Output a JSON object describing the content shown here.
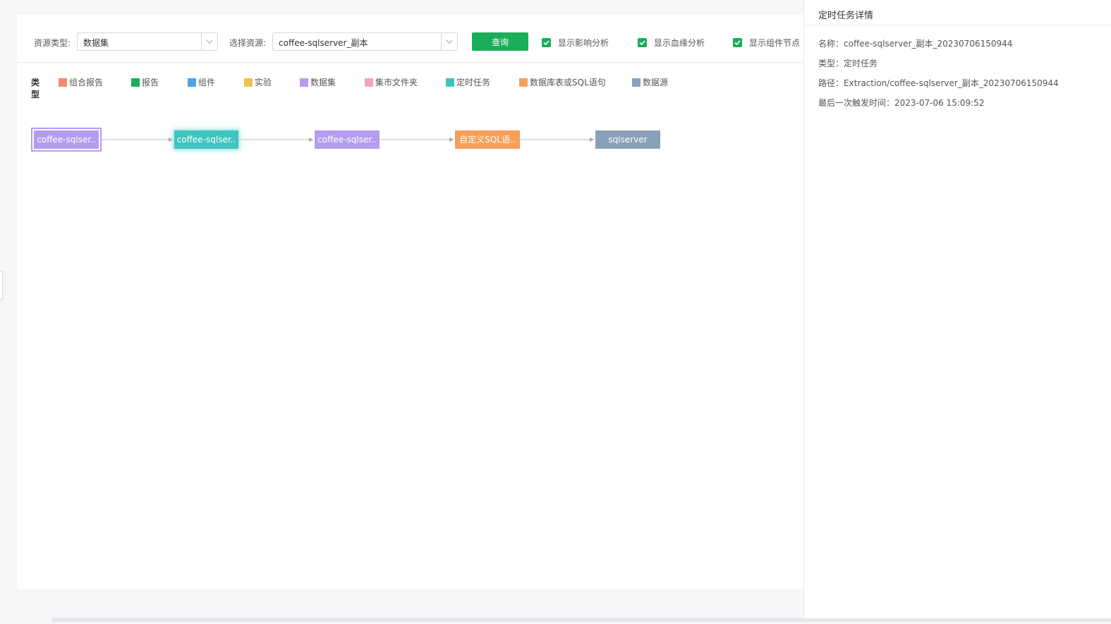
{
  "toolbar": {
    "resource_type_label": "资源类型:",
    "resource_type_value": "数据集",
    "select_resource_label": "选择资源:",
    "select_resource_value": "coffee-sqlserver_副本",
    "query_button": "查询",
    "checkboxes": [
      {
        "label": "显示影响分析",
        "checked": true
      },
      {
        "label": "显示血缘分析",
        "checked": true
      },
      {
        "label": "显示组件节点",
        "checked": true
      }
    ]
  },
  "legend": {
    "title": "类型",
    "items": [
      {
        "label": "组合报告",
        "color": "#f4896e"
      },
      {
        "label": "报告",
        "color": "#1aad5a"
      },
      {
        "label": "组件",
        "color": "#4da3e8"
      },
      {
        "label": "实验",
        "color": "#f2c04a"
      },
      {
        "label": "数据集",
        "color": "#b49cf0"
      },
      {
        "label": "集市文件夹",
        "color": "#f7a1c4"
      },
      {
        "label": "定时任务",
        "color": "#3fc4c0"
      },
      {
        "label": "数据库表或SQL语句",
        "color": "#f59f5b"
      },
      {
        "label": "数据源",
        "color": "#8aa0b8"
      }
    ]
  },
  "graph": {
    "nodes": [
      {
        "label": "coffee-sqlser..",
        "type": "数据集",
        "color": "#b49cf0",
        "selected": true
      },
      {
        "label": "coffee-sqlser..",
        "type": "定时任务",
        "color": "#3fc4c0",
        "highlight": true
      },
      {
        "label": "coffee-sqlser..",
        "type": "数据集",
        "color": "#b49cf0"
      },
      {
        "label": "自定义SQL语..",
        "type": "数据库表或SQL语句",
        "color": "#f59f5b"
      },
      {
        "label": "sqlserver",
        "type": "数据源",
        "color": "#8aa0b8"
      }
    ]
  },
  "side_panel": {
    "title": "定时任务详情",
    "name": "名称：coffee-sqlserver_副本_20230706150944",
    "type": "类型：定时任务",
    "path": "路径：Extraction/coffee-sqlserver_副本_20230706150944",
    "last_trigger": "最后一次触发时间：2023-07-06 15:09:52"
  }
}
